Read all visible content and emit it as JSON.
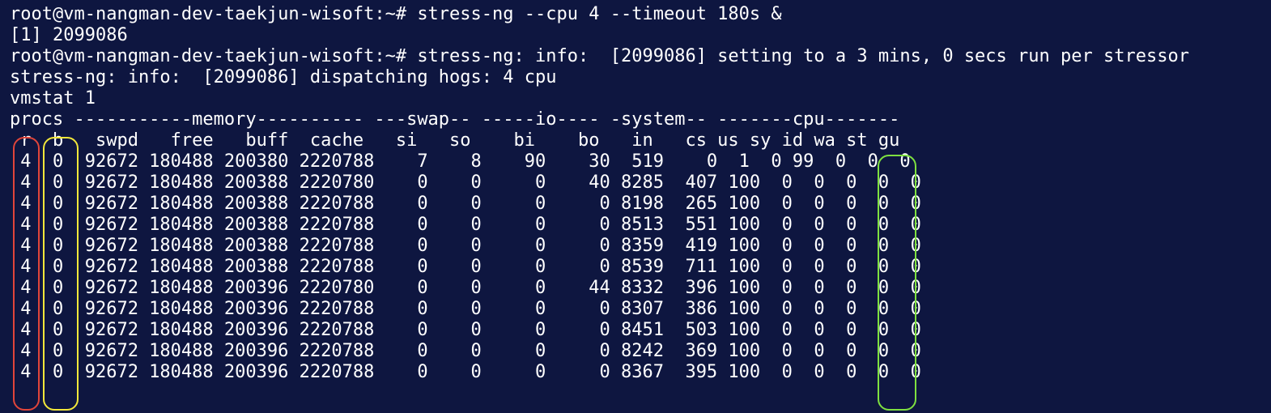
{
  "terminal": {
    "lines": [
      "root@vm-nangman-dev-taekjun-wisoft:~# stress-ng --cpu 4 --timeout 180s &",
      "[1] 2099086",
      "root@vm-nangman-dev-taekjun-wisoft:~# stress-ng: info:  [2099086] setting to a 3 mins, 0 secs run per stressor",
      "stress-ng: info:  [2099086] dispatching hogs: 4 cpu",
      "vmstat 1",
      "procs -----------memory---------- ---swap-- -----io---- -system-- -------cpu-------",
      " r  b   swpd   free   buff  cache   si   so    bi    bo   in   cs us sy id wa st gu",
      " 4  0  92672 180488 200380 2220788    7    8    90    30  519    0  1  0 99  0  0  0",
      " 4  0  92672 180488 200388 2220780    0    0     0    40 8285  407 100  0  0  0  0  0",
      " 4  0  92672 180488 200388 2220788    0    0     0     0 8198  265 100  0  0  0  0  0",
      " 4  0  92672 180488 200388 2220788    0    0     0     0 8513  551 100  0  0  0  0  0",
      " 4  0  92672 180488 200388 2220788    0    0     0     0 8359  419 100  0  0  0  0  0",
      " 4  0  92672 180488 200388 2220788    0    0     0     0 8539  711 100  0  0  0  0  0",
      " 4  0  92672 180488 200396 2220780    0    0     0    44 8332  396 100  0  0  0  0  0",
      " 4  0  92672 180488 200396 2220788    0    0     0     0 8307  386 100  0  0  0  0  0",
      " 4  0  92672 180488 200396 2220788    0    0     0     0 8451  503 100  0  0  0  0  0",
      " 4  0  92672 180488 200396 2220788    0    0     0     0 8242  369 100  0  0  0  0  0",
      " 4  0  92672 180488 200396 2220788    0    0     0     0 8367  395 100  0  0  0  0  0"
    ]
  },
  "highlights": {
    "r_column_color": "#e0453a",
    "b_column_color": "#f2e73a",
    "st_column_color": "#7ee040"
  },
  "colors": {
    "background": "#0e1640",
    "text": "#ffffff"
  }
}
